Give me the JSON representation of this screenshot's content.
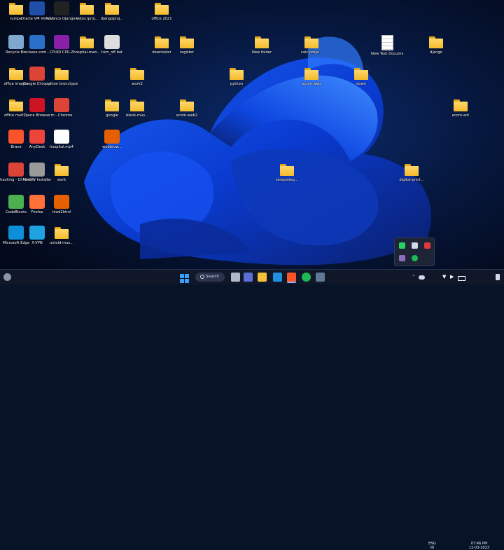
{
  "desktop": {
    "icons": [
      {
        "label": "lumpa",
        "type": "folder"
      },
      {
        "label": "Oracle VM VirtualBox",
        "type": "app",
        "color": "#1f4fa8"
      },
      {
        "label": "Advance Django Co...",
        "type": "app",
        "color": "#222222"
      },
      {
        "label": "webscrproj...",
        "type": "folder"
      },
      {
        "label": "djangoproj...",
        "type": "folder"
      },
      {
        "label": "office 2021",
        "type": "folder"
      },
      {
        "label": "Recycle Bin",
        "type": "app",
        "color": "#7fa8cf"
      },
      {
        "label": "eclasss-com...",
        "type": "app",
        "color": "#2a70c9"
      },
      {
        "label": "CPUID CPU-Z",
        "type": "app",
        "color": "#8a1fa8"
      },
      {
        "label": "hospital-man...",
        "type": "folder"
      },
      {
        "label": "turn_off.bat",
        "type": "app",
        "color": "#dddddd"
      },
      {
        "label": "downloder",
        "type": "folder"
      },
      {
        "label": "register",
        "type": "folder"
      },
      {
        "label": "New folder",
        "type": "folder"
      },
      {
        "label": "calc proje...",
        "type": "folder"
      },
      {
        "label": "New Text Document...",
        "type": "doc"
      },
      {
        "label": "django",
        "type": "folder"
      },
      {
        "label": "office images",
        "type": "folder"
      },
      {
        "label": "Google Chrome",
        "type": "app",
        "color": "#db4437"
      },
      {
        "label": "python bronctype",
        "type": "folder"
      },
      {
        "label": "work2",
        "type": "folder"
      },
      {
        "label": "python",
        "type": "folder"
      },
      {
        "label": "ecom web",
        "type": "folder"
      },
      {
        "label": "down",
        "type": "folder"
      },
      {
        "label": "office multi...",
        "type": "folder"
      },
      {
        "label": "Opera Browser",
        "type": "app",
        "color": "#cc1424"
      },
      {
        "label": "m - Chrome",
        "type": "app",
        "color": "#db4437"
      },
      {
        "label": "google",
        "type": "folder"
      },
      {
        "label": "blank-mus...",
        "type": "folder"
      },
      {
        "label": "ecom-web2",
        "type": "folder"
      },
      {
        "label": "ecom-ark",
        "type": "folder"
      },
      {
        "label": "Brave",
        "type": "app",
        "color": "#fb542b"
      },
      {
        "label": "AnyDesk",
        "type": "app",
        "color": "#ef443b"
      },
      {
        "label": "hospital.mp4",
        "type": "app",
        "color": "#ffffff"
      },
      {
        "label": "webbrow...",
        "type": "app",
        "color": "#e66000"
      },
      {
        "label": "hacking - Chrome",
        "type": "app",
        "color": "#db4437"
      },
      {
        "label": "MinGW Installer",
        "type": "app",
        "color": "#9a9a9a"
      },
      {
        "label": "work",
        "type": "folder"
      },
      {
        "label": "templateg...",
        "type": "folder"
      },
      {
        "label": "digital-print...",
        "type": "folder"
      },
      {
        "label": "CodeBlocks",
        "type": "app",
        "color": "#4caf50"
      },
      {
        "label": "Firefox",
        "type": "app",
        "color": "#ff7139"
      },
      {
        "label": "tired2html",
        "type": "app",
        "color": "#e66000"
      },
      {
        "label": "Microsoft Edge",
        "type": "app",
        "color": "#0c8ed9"
      },
      {
        "label": "X-VPN",
        "type": "app",
        "color": "#1fa3e0"
      },
      {
        "label": "untold-mus...",
        "type": "folder"
      }
    ]
  },
  "taskbar": {
    "search_label": "Search",
    "language": "ENG",
    "region": "IN",
    "time": "07:46 PM",
    "date": "12-03-2023",
    "apps": [
      "start",
      "search",
      "task-view",
      "meet",
      "file-explorer",
      "vscode",
      "brave",
      "spotify",
      "notes",
      "settings"
    ]
  },
  "tray_popup": {
    "icons": [
      "whatsapp-icon",
      "send-icon",
      "red-app-icon",
      "purple-app-icon",
      "spotify-icon"
    ]
  }
}
